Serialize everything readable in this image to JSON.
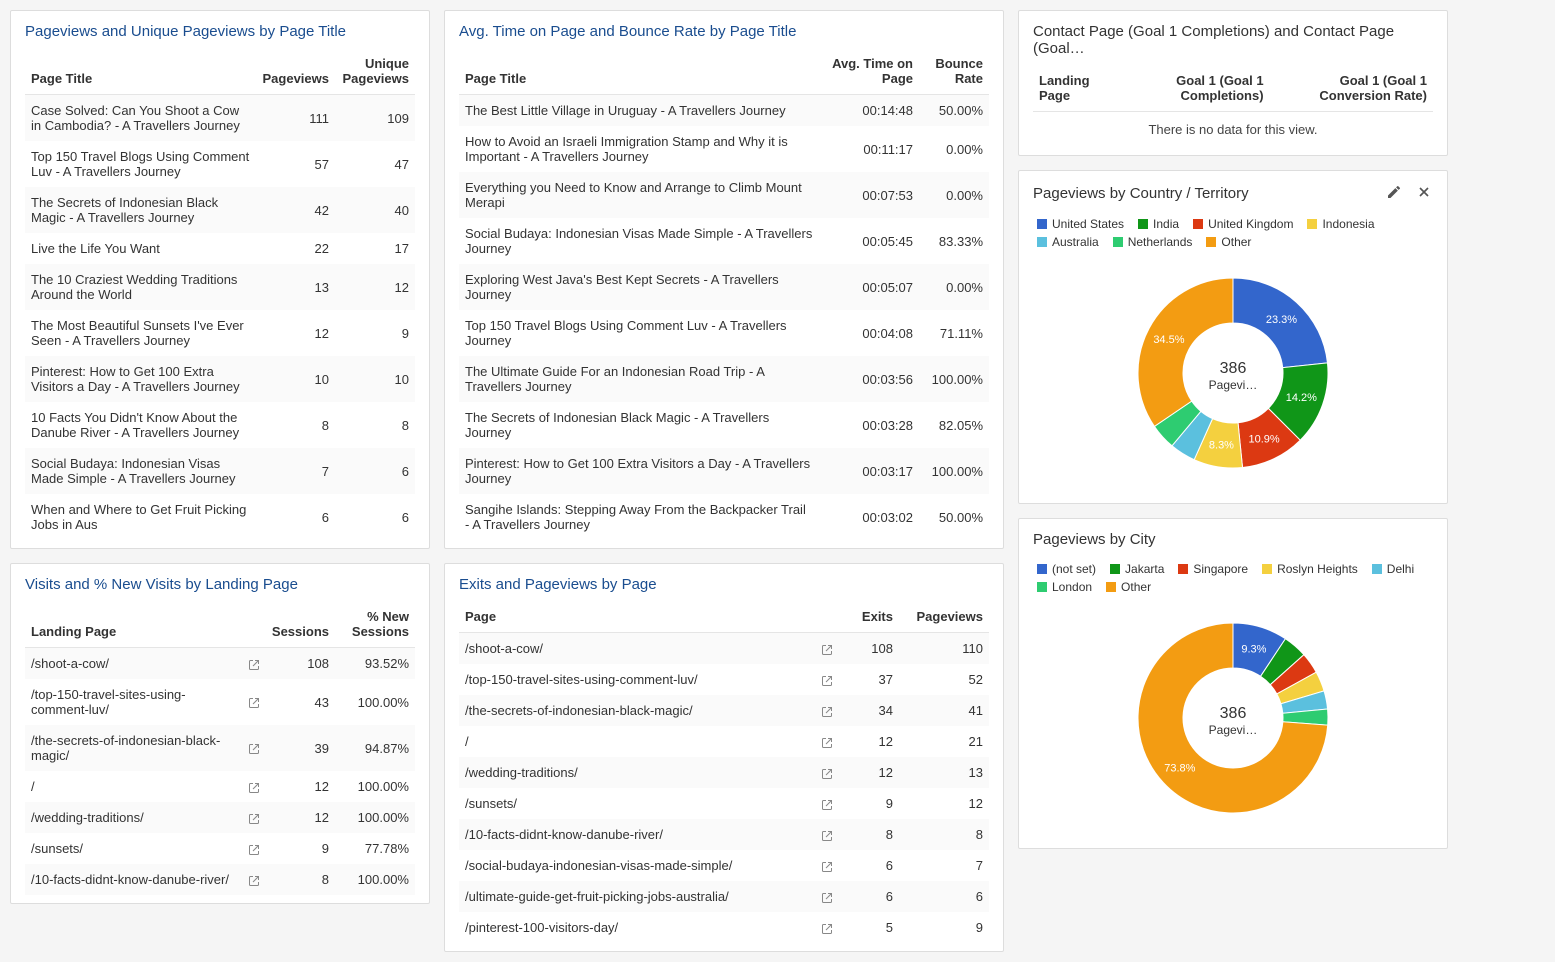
{
  "panels": {
    "pageviews": {
      "title": "Pageviews and Unique Pageviews by Page Title",
      "headers": [
        "Page Title",
        "Pageviews",
        "Unique Pageviews"
      ],
      "rows": [
        {
          "title": "Case Solved: Can You Shoot a Cow in Cambodia? - A Travellers Journey",
          "pv": "111",
          "upv": "109"
        },
        {
          "title": "Top 150 Travel Blogs Using Comment Luv - A Travellers Journey",
          "pv": "57",
          "upv": "47"
        },
        {
          "title": "The Secrets of Indonesian Black Magic - A Travellers Journey",
          "pv": "42",
          "upv": "40"
        },
        {
          "title": "Live the Life You Want",
          "pv": "22",
          "upv": "17"
        },
        {
          "title": "The 10 Craziest Wedding Traditions Around the World",
          "pv": "13",
          "upv": "12"
        },
        {
          "title": "The Most Beautiful Sunsets I've Ever Seen - A Travellers Journey",
          "pv": "12",
          "upv": "9"
        },
        {
          "title": "Pinterest: How to Get 100 Extra Visitors a Day - A Travellers Journey",
          "pv": "10",
          "upv": "10"
        },
        {
          "title": "10 Facts You Didn't Know About the Danube River - A Travellers Journey",
          "pv": "8",
          "upv": "8"
        },
        {
          "title": "Social Budaya: Indonesian Visas Made Simple - A Travellers Journey",
          "pv": "7",
          "upv": "6"
        },
        {
          "title": "When and Where to Get Fruit Picking Jobs in Aus",
          "pv": "6",
          "upv": "6"
        }
      ]
    },
    "visits": {
      "title": "Visits and % New Visits by Landing Page",
      "headers": [
        "Landing Page",
        "Sessions",
        "% New Sessions"
      ],
      "rows": [
        {
          "page": "/shoot-a-cow/",
          "sessions": "108",
          "pct": "93.52%"
        },
        {
          "page": "/top-150-travel-sites-using-comment-luv/",
          "sessions": "43",
          "pct": "100.00%"
        },
        {
          "page": "/the-secrets-of-indonesian-black-magic/",
          "sessions": "39",
          "pct": "94.87%"
        },
        {
          "page": "/",
          "sessions": "12",
          "pct": "100.00%"
        },
        {
          "page": "/wedding-traditions/",
          "sessions": "12",
          "pct": "100.00%"
        },
        {
          "page": "/sunsets/",
          "sessions": "9",
          "pct": "77.78%"
        },
        {
          "page": "/10-facts-didnt-know-danube-river/",
          "sessions": "8",
          "pct": "100.00%"
        }
      ]
    },
    "avgtime": {
      "title": "Avg. Time on Page and Bounce Rate by Page Title",
      "headers": [
        "Page Title",
        "Avg. Time on Page",
        "Bounce Rate"
      ],
      "rows": [
        {
          "title": "The Best Little Village in Uruguay - A Travellers Journey",
          "time": "00:14:48",
          "bounce": "50.00%"
        },
        {
          "title": "How to Avoid an Israeli Immigration Stamp and Why it is Important - A Travellers Journey",
          "time": "00:11:17",
          "bounce": "0.00%"
        },
        {
          "title": "Everything you Need to Know and Arrange to Climb Mount Merapi",
          "time": "00:07:53",
          "bounce": "0.00%"
        },
        {
          "title": "Social Budaya: Indonesian Visas Made Simple - A Travellers Journey",
          "time": "00:05:45",
          "bounce": "83.33%"
        },
        {
          "title": "Exploring West Java's Best Kept Secrets - A Travellers Journey",
          "time": "00:05:07",
          "bounce": "0.00%"
        },
        {
          "title": "Top 150 Travel Blogs Using Comment Luv - A Travellers Journey",
          "time": "00:04:08",
          "bounce": "71.11%"
        },
        {
          "title": "The Ultimate Guide For an Indonesian Road Trip - A Travellers Journey",
          "time": "00:03:56",
          "bounce": "100.00%"
        },
        {
          "title": "The Secrets of Indonesian Black Magic - A Travellers Journey",
          "time": "00:03:28",
          "bounce": "82.05%"
        },
        {
          "title": "Pinterest: How to Get 100 Extra Visitors a Day - A Travellers Journey",
          "time": "00:03:17",
          "bounce": "100.00%"
        },
        {
          "title": "Sangihe Islands: Stepping Away From the Backpacker Trail - A Travellers Journey",
          "time": "00:03:02",
          "bounce": "50.00%"
        }
      ]
    },
    "exits": {
      "title": "Exits and Pageviews by Page",
      "headers": [
        "Page",
        "Exits",
        "Pageviews"
      ],
      "rows": [
        {
          "page": "/shoot-a-cow/",
          "exits": "108",
          "pv": "110"
        },
        {
          "page": "/top-150-travel-sites-using-comment-luv/",
          "exits": "37",
          "pv": "52"
        },
        {
          "page": "/the-secrets-of-indonesian-black-magic/",
          "exits": "34",
          "pv": "41"
        },
        {
          "page": "/",
          "exits": "12",
          "pv": "21"
        },
        {
          "page": "/wedding-traditions/",
          "exits": "12",
          "pv": "13"
        },
        {
          "page": "/sunsets/",
          "exits": "9",
          "pv": "12"
        },
        {
          "page": "/10-facts-didnt-know-danube-river/",
          "exits": "8",
          "pv": "8"
        },
        {
          "page": "/social-budaya-indonesian-visas-made-simple/",
          "exits": "6",
          "pv": "7"
        },
        {
          "page": "/ultimate-guide-get-fruit-picking-jobs-australia/",
          "exits": "6",
          "pv": "6"
        },
        {
          "page": "/pinterest-100-visitors-day/",
          "exits": "5",
          "pv": "9"
        }
      ]
    },
    "contact": {
      "title": "Contact Page (Goal 1 Completions) and Contact Page (Goal…",
      "headers": [
        "Landing Page",
        "Goal 1 (Goal 1 Completions)",
        "Goal 1 (Goal 1 Conversion Rate)"
      ],
      "nodata": "There is no data for this view."
    },
    "country": {
      "title": "Pageviews by Country / Territory",
      "legend": [
        {
          "name": "United States",
          "color": "#3366cc"
        },
        {
          "name": "India",
          "color": "#109618"
        },
        {
          "name": "United Kingdom",
          "color": "#dc3912"
        },
        {
          "name": "Indonesia",
          "color": "#f4d03f"
        },
        {
          "name": "Australia",
          "color": "#5bc0de"
        },
        {
          "name": "Netherlands",
          "color": "#2ecc71"
        },
        {
          "name": "Other",
          "color": "#f39c12"
        }
      ],
      "center_value": "386",
      "center_label": "Pagevi…"
    },
    "city": {
      "title": "Pageviews by City",
      "legend": [
        {
          "name": "(not set)",
          "color": "#3366cc"
        },
        {
          "name": "Jakarta",
          "color": "#109618"
        },
        {
          "name": "Singapore",
          "color": "#dc3912"
        },
        {
          "name": "Roslyn Heights",
          "color": "#f4d03f"
        },
        {
          "name": "Delhi",
          "color": "#5bc0de"
        },
        {
          "name": "London",
          "color": "#2ecc71"
        },
        {
          "name": "Other",
          "color": "#f39c12"
        }
      ],
      "center_value": "386",
      "center_label": "Pagevi…"
    }
  },
  "chart_data": [
    {
      "type": "pie",
      "title": "Pageviews by Country / Territory",
      "total": 386,
      "series": [
        {
          "name": "United States",
          "pct": 23.3,
          "color": "#3366cc"
        },
        {
          "name": "India",
          "pct": 14.2,
          "color": "#109618"
        },
        {
          "name": "United Kingdom",
          "pct": 10.9,
          "color": "#dc3912"
        },
        {
          "name": "Indonesia",
          "pct": 8.3,
          "color": "#f4d03f"
        },
        {
          "name": "Australia",
          "pct": 4.4,
          "color": "#5bc0de"
        },
        {
          "name": "Netherlands",
          "pct": 4.4,
          "color": "#2ecc71"
        },
        {
          "name": "Other",
          "pct": 34.5,
          "color": "#f39c12"
        }
      ]
    },
    {
      "type": "pie",
      "title": "Pageviews by City",
      "total": 386,
      "series": [
        {
          "name": "(not set)",
          "pct": 9.3,
          "color": "#3366cc"
        },
        {
          "name": "Jakarta",
          "pct": 4.1,
          "color": "#109618"
        },
        {
          "name": "Singapore",
          "pct": 3.6,
          "color": "#dc3912"
        },
        {
          "name": "Roslyn Heights",
          "pct": 3.4,
          "color": "#f4d03f"
        },
        {
          "name": "Delhi",
          "pct": 3.1,
          "color": "#5bc0de"
        },
        {
          "name": "London",
          "pct": 2.7,
          "color": "#2ecc71"
        },
        {
          "name": "Other",
          "pct": 73.8,
          "color": "#f39c12"
        }
      ]
    }
  ]
}
